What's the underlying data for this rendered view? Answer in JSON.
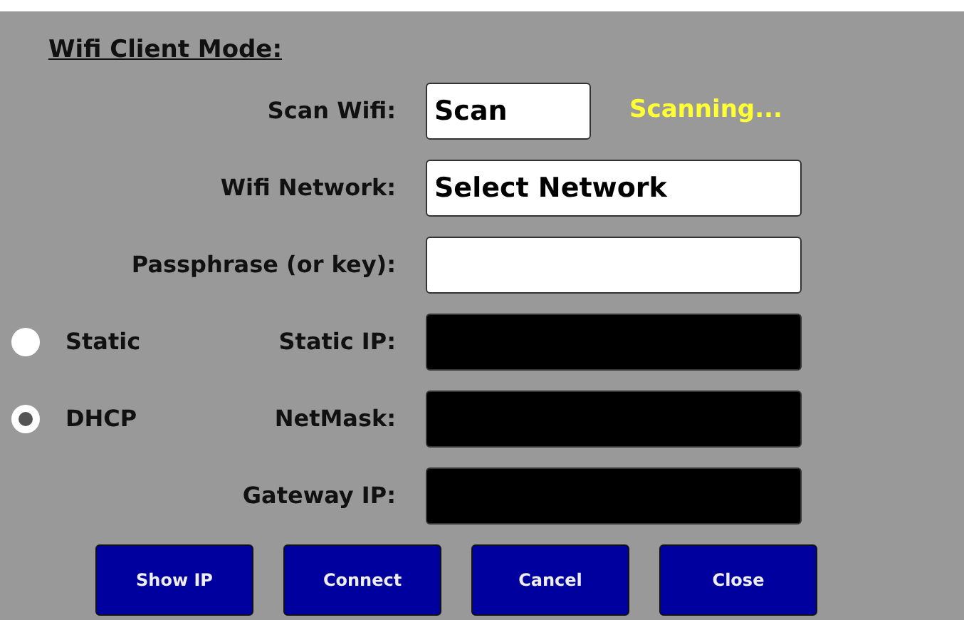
{
  "title": "Wifi Client Mode:",
  "rows": [
    {
      "label": "Scan Wifi:",
      "kind": "button",
      "value": "Scan",
      "status": "Scanning..."
    },
    {
      "label": "Wifi Network:",
      "kind": "input",
      "value": "Select Network",
      "disabled": false
    },
    {
      "label": "Passphrase (or key):",
      "kind": "input",
      "disabled": false
    },
    {
      "label": "Static IP:",
      "kind": "input",
      "disabled": true,
      "option": {
        "label": "Static",
        "selected": false
      }
    },
    {
      "label": "NetMask:",
      "kind": "input",
      "disabled": true,
      "option": {
        "label": "DHCP",
        "selected": true
      }
    },
    {
      "label": "Gateway IP:",
      "kind": "input",
      "disabled": true
    }
  ],
  "buttons": [
    "Show IP",
    "Connect",
    "Cancel",
    "Close"
  ]
}
